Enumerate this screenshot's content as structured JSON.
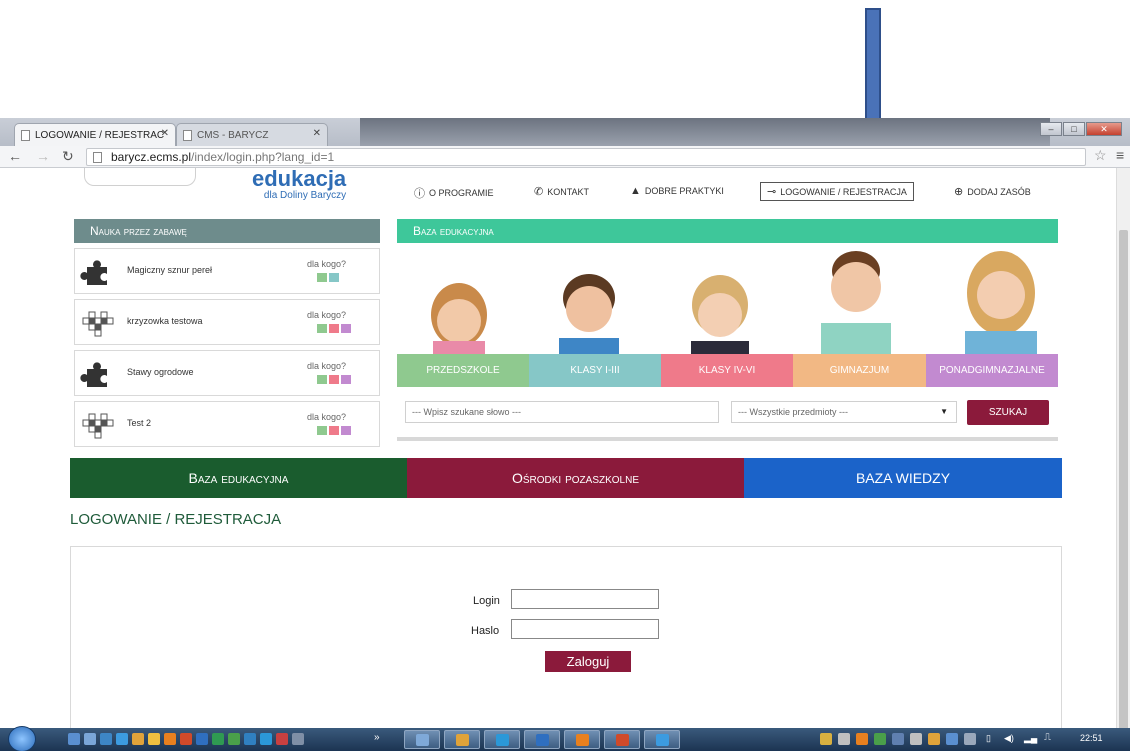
{
  "browser": {
    "tabs": [
      {
        "label": "LOGOWANIE / REJESTRAC",
        "active": true
      },
      {
        "label": "CMS - BARYCZ",
        "active": false
      }
    ],
    "url_host": "barycz.ecms.pl",
    "url_path": "/index/login.php?lang_id=1"
  },
  "header": {
    "logo_main": "edukacja",
    "logo_sub": "dla Doliny Baryczy",
    "nav": [
      {
        "icon": "info-icon",
        "label": "O PROGRAMIE"
      },
      {
        "icon": "phone-icon",
        "label": "KONTAKT"
      },
      {
        "icon": "thumbs-up-icon",
        "label": "DOBRE PRAKTYKI"
      },
      {
        "icon": "key-icon",
        "label": "LOGOWANIE / REJESTRACJA"
      },
      {
        "icon": "plus-circle-icon",
        "label": "DODAJ ZASÓB"
      }
    ]
  },
  "left_panel": {
    "title": "Nauka przez zabawę",
    "items": [
      {
        "title": "Magiczny sznur pereł",
        "who": "dla kogo?",
        "icon": "puzzle-icon",
        "colors": [
          "#8fc98f",
          "#86c7c7"
        ]
      },
      {
        "title": "krzyzowka testowa",
        "who": "dla kogo?",
        "icon": "crossword-icon",
        "colors": [
          "#8fc98f",
          "#ef7a8a",
          "#c28ad0"
        ]
      },
      {
        "title": "Stawy ogrodowe",
        "who": "dla kogo?",
        "icon": "puzzle-icon",
        "colors": [
          "#8fc98f",
          "#ef7a8a",
          "#c28ad0"
        ]
      },
      {
        "title": "Test 2",
        "who": "dla kogo?",
        "icon": "crossword-icon",
        "colors": [
          "#8fc98f",
          "#ef7a8a",
          "#c28ad0"
        ]
      }
    ]
  },
  "right_panel": {
    "title": "Baza edukacyjna",
    "categories": [
      {
        "label": "PRZEDSZKOLE",
        "color": "#8fc98f"
      },
      {
        "label": "KLASY I-III",
        "color": "#86c7c7"
      },
      {
        "label": "KLASY IV-VI",
        "color": "#ef7a8a"
      },
      {
        "label": "GIMNAZJUM",
        "color": "#f2b884"
      },
      {
        "label": "PONADGIMNAZJALNE",
        "color": "#c28ad0"
      }
    ],
    "search_placeholder": "--- Wpisz szukane słowo ---",
    "select_value": "--- Wszystkie przedmioty ---",
    "search_button": "SZUKAJ"
  },
  "big_nav": [
    {
      "label": "Baza edukacyjna",
      "color": "#1a5c2e"
    },
    {
      "label": "Ośrodki pozaszkolne",
      "color": "#8b1a3b"
    },
    {
      "label": "BAZA WIEDZY",
      "color": "#1b63c9"
    }
  ],
  "section_title": "LOGOWANIE / REJESTRACJA",
  "form": {
    "login_label": "Login",
    "password_label": "Haslo",
    "submit_label": "Zaloguj"
  },
  "taskbar": {
    "clock": "22:51"
  }
}
